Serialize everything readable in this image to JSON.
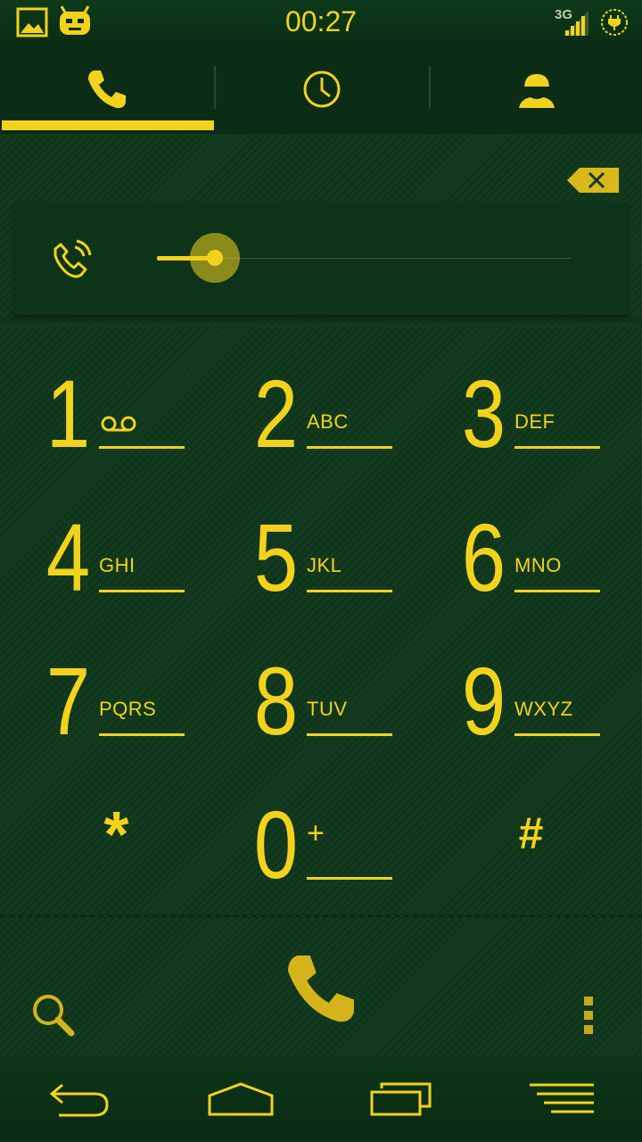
{
  "status_bar": {
    "time": "00:27",
    "network_type": "3G",
    "icons": [
      "gallery-icon",
      "cyanogen-mascot-icon",
      "signal-icon",
      "battery-charging-icon"
    ]
  },
  "tabs": [
    {
      "name": "dialer",
      "icon": "phone-icon",
      "selected": true
    },
    {
      "name": "call-log",
      "icon": "clock-icon",
      "selected": false
    },
    {
      "name": "contacts",
      "icon": "contact-icon",
      "selected": false
    }
  ],
  "call_card": {
    "icon": "phone-ringing-icon",
    "slider_value": 0.14
  },
  "keys": [
    {
      "digit": "1",
      "letters": "",
      "voicemail": true
    },
    {
      "digit": "2",
      "letters": "ABC"
    },
    {
      "digit": "3",
      "letters": "DEF"
    },
    {
      "digit": "4",
      "letters": "GHI"
    },
    {
      "digit": "5",
      "letters": "JKL"
    },
    {
      "digit": "6",
      "letters": "MNO"
    },
    {
      "digit": "7",
      "letters": "PQRS"
    },
    {
      "digit": "8",
      "letters": "TUV"
    },
    {
      "digit": "9",
      "letters": "WXYZ"
    },
    {
      "symbol": "*"
    },
    {
      "digit": "0",
      "letters": "+"
    },
    {
      "symbol": "#"
    }
  ],
  "action_bar": {
    "icons": [
      "search-icon",
      "call-icon",
      "overflow-menu-icon"
    ]
  },
  "nav_bar": {
    "icons": [
      "back-icon",
      "home-icon",
      "recent-apps-icon",
      "menu-icon"
    ]
  },
  "colors": {
    "accent": "#f2d21b",
    "background": "#123a1e",
    "bar": "#0b2c15"
  }
}
